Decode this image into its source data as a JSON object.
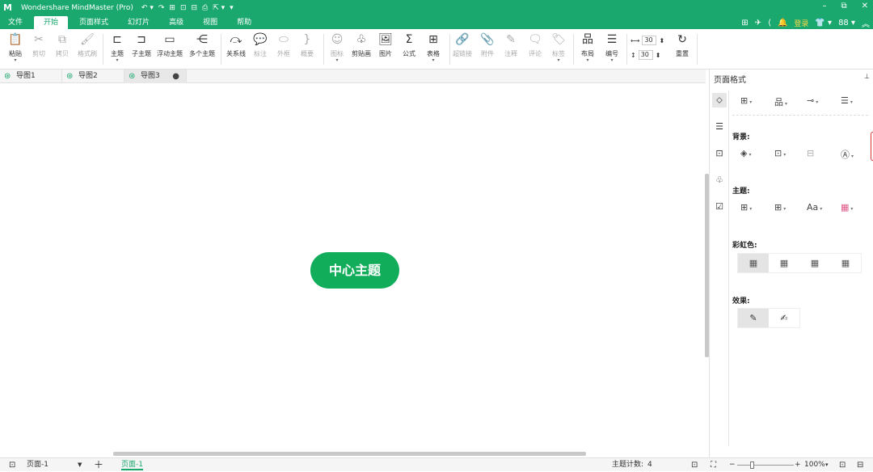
{
  "app": {
    "title": "Wondershare MindMaster (Pro)",
    "logo": "M",
    "quick_access": [
      "↶ ▾",
      "↷",
      "⊞",
      "⊡",
      "⊟",
      "⎙",
      "⇱ ▾",
      "▾"
    ],
    "window_controls": [
      "–",
      "⧉",
      "✕"
    ]
  },
  "menu": {
    "items": [
      "文件",
      "开始",
      "页面样式",
      "幻灯片",
      "高级",
      "视图",
      "帮助"
    ],
    "active": "开始",
    "right": {
      "login": "登录",
      "icons": [
        "⊞",
        "✈",
        "⟨",
        "🔔",
        "👕 ▾",
        "88 ▾",
        "︽"
      ]
    }
  },
  "ribbon": {
    "paste": {
      "icon": "📋",
      "label": "粘贴"
    },
    "cut": {
      "icon": "✂",
      "label": "剪切"
    },
    "copy": {
      "icon": "⧉",
      "label": "拷贝"
    },
    "format_painter": {
      "icon": "🖌",
      "label": "格式刷"
    },
    "topic": {
      "icon": "⊏",
      "label": "主题"
    },
    "subtopic": {
      "icon": "⊐",
      "label": "子主题"
    },
    "floating_topic": {
      "icon": "▭",
      "label": "浮动主题"
    },
    "multiple_topics": {
      "icon": "⋲",
      "label": "多个主题"
    },
    "relationship": {
      "icon": "⤼",
      "label": "关系线"
    },
    "callout": {
      "icon": "💬",
      "label": "标注"
    },
    "boundary": {
      "icon": "⬭",
      "label": "外框"
    },
    "summary": {
      "icon": "}",
      "label": "概要"
    },
    "icon": {
      "icon": "☺",
      "label": "图标"
    },
    "clipart": {
      "icon": "♧",
      "label": "剪贴画"
    },
    "picture": {
      "icon": "🖼",
      "label": "图片"
    },
    "formula": {
      "icon": "Σ",
      "label": "公式"
    },
    "table": {
      "icon": "⊞",
      "label": "表格"
    },
    "hyperlink": {
      "icon": "🔗",
      "label": "超链接"
    },
    "attachment": {
      "icon": "📎",
      "label": "附件"
    },
    "note": {
      "icon": "✎",
      "label": "注释"
    },
    "comment": {
      "icon": "🗨",
      "label": "评论"
    },
    "tag": {
      "icon": "🏷",
      "label": "标签"
    },
    "layout": {
      "icon": "品",
      "label": "布局"
    },
    "numbering": {
      "icon": "☰",
      "label": "编号"
    },
    "width_value": "30",
    "height_value": "30",
    "reset": {
      "icon": "↻",
      "label": "重置"
    }
  },
  "doc_tabs": [
    {
      "label": "导图1"
    },
    {
      "label": "导图2"
    },
    {
      "label": "导图3"
    }
  ],
  "canvas": {
    "central_topic": "中心主题"
  },
  "panel": {
    "title": "页面格式",
    "pin": "⊥",
    "background_label": "背景:",
    "theme_label": "主题:",
    "rainbow_label": "彩虹色:",
    "effects_label": "效果:",
    "font_icon": "Aa"
  },
  "status": {
    "page_select": "页面-1",
    "page_tab": "页面-1",
    "topic_count_label": "主题计数:",
    "topic_count": "4",
    "zoom": "100%",
    "accent_color": "#1aa86e"
  }
}
